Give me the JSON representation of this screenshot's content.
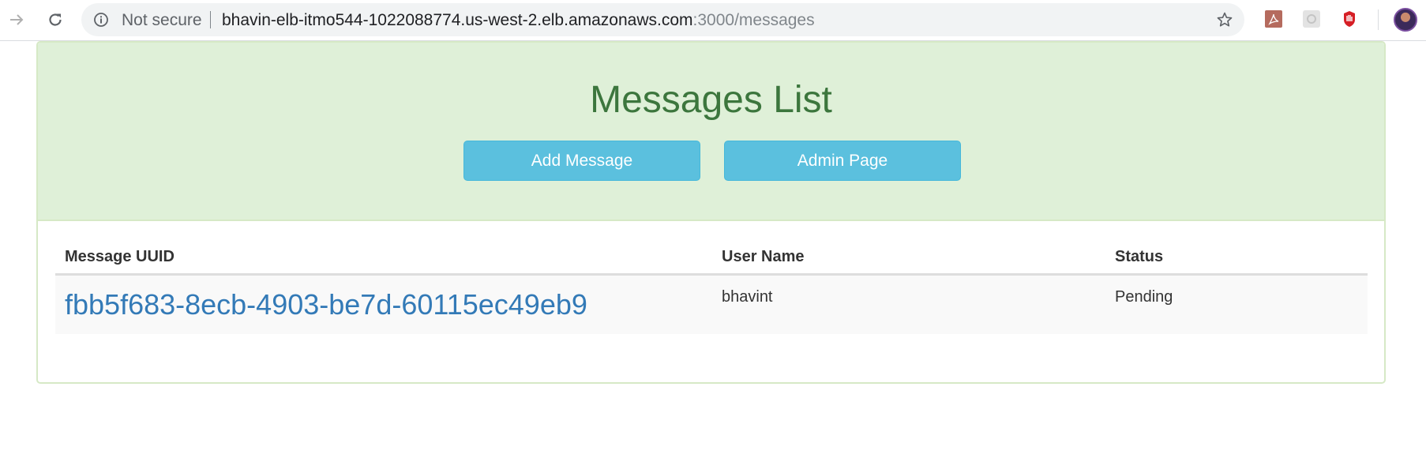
{
  "browser": {
    "security_label": "Not secure",
    "url_host": "bhavin-elb-itmo544-1022088774.us-west-2.elb.amazonaws.com",
    "url_path": ":3000/messages",
    "icons": {
      "back": "arrow-right-icon",
      "reload": "reload-icon",
      "info": "info-icon",
      "bookmark": "star-icon",
      "extensions": [
        "pdf-extension-icon",
        "gray-extension-icon",
        "red-hand-extension-icon"
      ],
      "profile": "avatar"
    }
  },
  "page": {
    "title": "Messages List",
    "buttons": {
      "add_message": "Add Message",
      "admin_page": "Admin Page"
    },
    "table": {
      "headers": [
        "Message UUID",
        "User Name",
        "Status"
      ],
      "rows": [
        {
          "uuid": "fbb5f683-8ecb-4903-be7d-60115ec49eb9",
          "user_name": "bhavint",
          "status": "Pending"
        }
      ]
    }
  },
  "colors": {
    "heading_bg": "#dff0d8",
    "heading_text": "#3c763d",
    "button_bg": "#5bc0de",
    "link": "#337ab7"
  }
}
